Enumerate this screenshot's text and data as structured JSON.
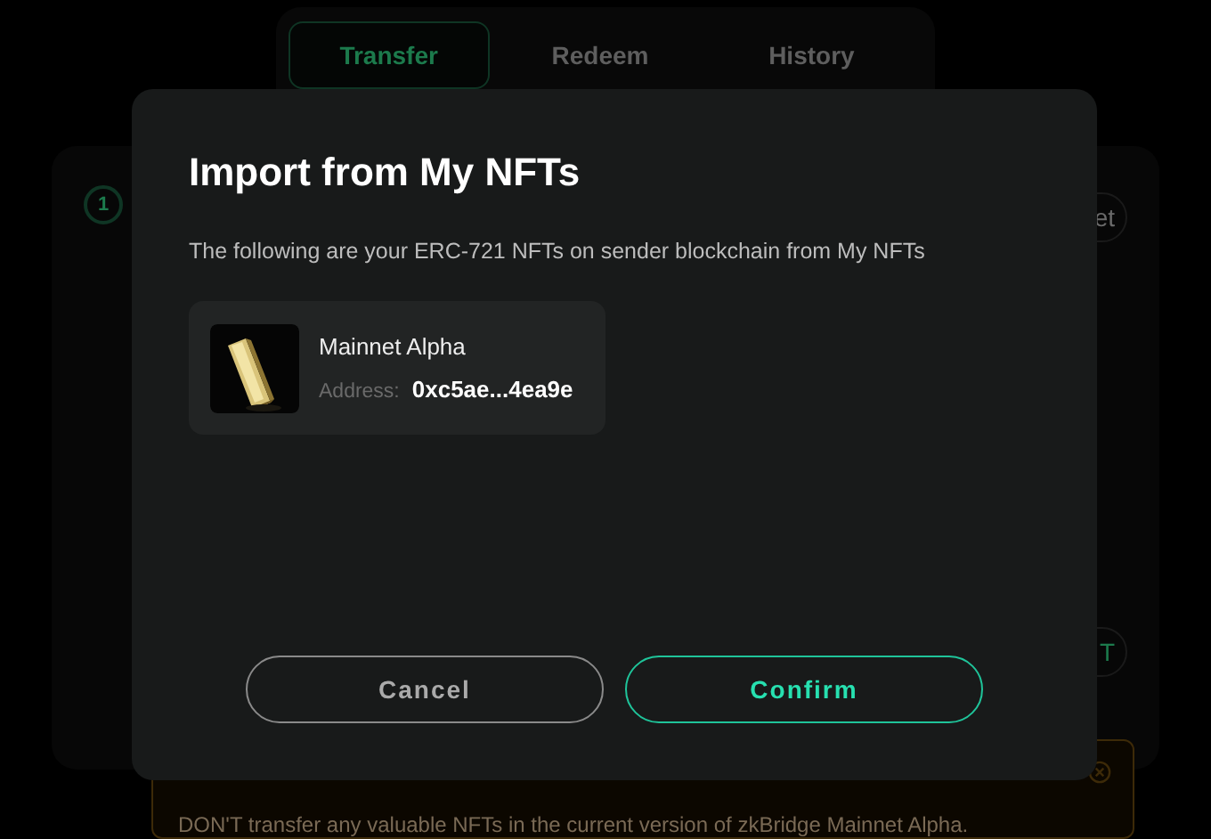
{
  "tabs": [
    {
      "label": "Transfer",
      "selected": true
    },
    {
      "label": "Redeem",
      "selected": false
    },
    {
      "label": "History",
      "selected": false
    }
  ],
  "step": {
    "number": "1"
  },
  "side_buttons": [
    {
      "label": "et",
      "kind": "plain"
    },
    {
      "label": "T",
      "kind": "accent"
    }
  ],
  "warning": {
    "text": "DON'T transfer any valuable NFTs in the current version of zkBridge Mainnet Alpha."
  },
  "dialog": {
    "title": "Import from My NFTs",
    "description": "The following are your ERC-721 NFTs on sender blockchain from My NFTs",
    "nfts": [
      {
        "name": "Mainnet Alpha",
        "address_label": "Address:",
        "address": "0xc5ae...4ea9e"
      }
    ],
    "buttons": [
      {
        "label": "Cancel",
        "kind": "secondary"
      },
      {
        "label": "Confirm",
        "kind": "primary"
      }
    ]
  }
}
